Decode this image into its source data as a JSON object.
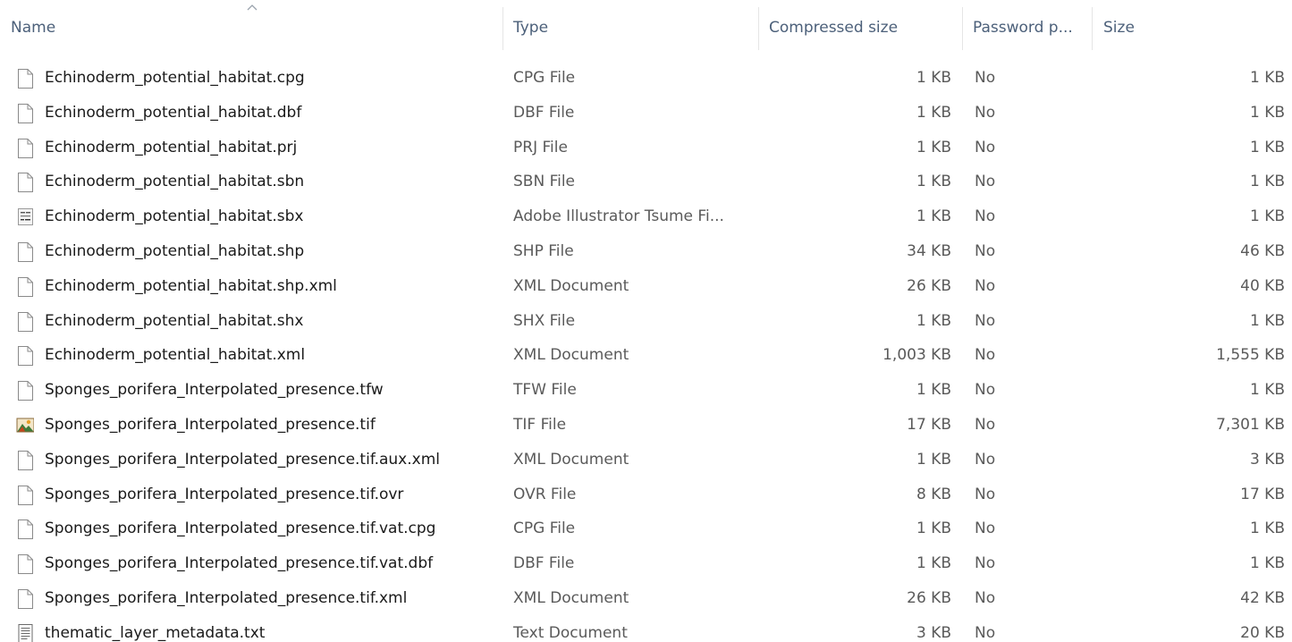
{
  "header": {
    "name": "Name",
    "type": "Type",
    "compressed_size": "Compressed size",
    "password": "Password p...",
    "size": "Size",
    "sorted_column": "name",
    "sort_indicator_icon": "chevron-up-icon"
  },
  "files": [
    {
      "icon": "file-icon",
      "name": "Echinoderm_potential_habitat.cpg",
      "type": "CPG File",
      "compressed": "1 KB",
      "password": "No",
      "size": "1 KB"
    },
    {
      "icon": "file-icon",
      "name": "Echinoderm_potential_habitat.dbf",
      "type": "DBF File",
      "compressed": "1 KB",
      "password": "No",
      "size": "1 KB"
    },
    {
      "icon": "file-icon",
      "name": "Echinoderm_potential_habitat.prj",
      "type": "PRJ File",
      "compressed": "1 KB",
      "password": "No",
      "size": "1 KB"
    },
    {
      "icon": "file-icon",
      "name": "Echinoderm_potential_habitat.sbn",
      "type": "SBN File",
      "compressed": "1 KB",
      "password": "No",
      "size": "1 KB"
    },
    {
      "icon": "illustrator-tsume-icon",
      "name": "Echinoderm_potential_habitat.sbx",
      "type": "Adobe Illustrator Tsume Fi...",
      "compressed": "1 KB",
      "password": "No",
      "size": "1 KB"
    },
    {
      "icon": "file-icon",
      "name": "Echinoderm_potential_habitat.shp",
      "type": "SHP File",
      "compressed": "34 KB",
      "password": "No",
      "size": "46 KB"
    },
    {
      "icon": "file-icon",
      "name": "Echinoderm_potential_habitat.shp.xml",
      "type": "XML Document",
      "compressed": "26 KB",
      "password": "No",
      "size": "40 KB"
    },
    {
      "icon": "file-icon",
      "name": "Echinoderm_potential_habitat.shx",
      "type": "SHX File",
      "compressed": "1 KB",
      "password": "No",
      "size": "1 KB"
    },
    {
      "icon": "file-icon",
      "name": "Echinoderm_potential_habitat.xml",
      "type": "XML Document",
      "compressed": "1,003 KB",
      "password": "No",
      "size": "1,555 KB"
    },
    {
      "icon": "file-icon",
      "name": "Sponges_porifera_Interpolated_presence.tfw",
      "type": "TFW File",
      "compressed": "1 KB",
      "password": "No",
      "size": "1 KB"
    },
    {
      "icon": "image-file-icon",
      "name": "Sponges_porifera_Interpolated_presence.tif",
      "type": "TIF File",
      "compressed": "17 KB",
      "password": "No",
      "size": "7,301 KB"
    },
    {
      "icon": "file-icon",
      "name": "Sponges_porifera_Interpolated_presence.tif.aux.xml",
      "type": "XML Document",
      "compressed": "1 KB",
      "password": "No",
      "size": "3 KB"
    },
    {
      "icon": "file-icon",
      "name": "Sponges_porifera_Interpolated_presence.tif.ovr",
      "type": "OVR File",
      "compressed": "8 KB",
      "password": "No",
      "size": "17 KB"
    },
    {
      "icon": "file-icon",
      "name": "Sponges_porifera_Interpolated_presence.tif.vat.cpg",
      "type": "CPG File",
      "compressed": "1 KB",
      "password": "No",
      "size": "1 KB"
    },
    {
      "icon": "file-icon",
      "name": "Sponges_porifera_Interpolated_presence.tif.vat.dbf",
      "type": "DBF File",
      "compressed": "1 KB",
      "password": "No",
      "size": "1 KB"
    },
    {
      "icon": "file-icon",
      "name": "Sponges_porifera_Interpolated_presence.tif.xml",
      "type": "XML Document",
      "compressed": "26 KB",
      "password": "No",
      "size": "42 KB"
    },
    {
      "icon": "text-document-icon",
      "name": "thematic_layer_metadata.txt",
      "type": "Text Document",
      "compressed": "3 KB",
      "password": "No",
      "size": "20 KB"
    }
  ]
}
